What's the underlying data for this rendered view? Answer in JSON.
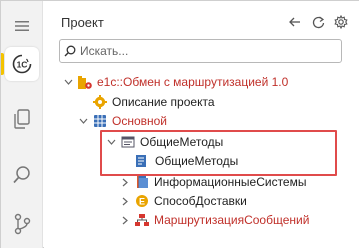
{
  "panel": {
    "title": "Проект",
    "search_placeholder": "Искать..."
  },
  "tree": {
    "root": "e1c::Обмен с маршрутизацией 1.0",
    "project_description": "Описание проекта",
    "main": "Основной",
    "common_methods_folder": "ОбщиеМетоды",
    "common_methods_item": "ОбщиеМетоды",
    "info_systems": "ИнформационныеСистемы",
    "delivery_method": "СпособДоставки",
    "message_routing": "МаршрутизацияСообщений"
  },
  "colors": {
    "accent": "#f5c400",
    "highlight": "#e04b4b",
    "red_text": "#c0302a"
  },
  "icons": {
    "activity": [
      "menu-icon",
      "1c-logo-icon",
      "files-icon",
      "search-icon",
      "source-control-icon"
    ],
    "toolbar": [
      "back-arrow-icon",
      "refresh-icon",
      "settings-gear-icon"
    ]
  }
}
